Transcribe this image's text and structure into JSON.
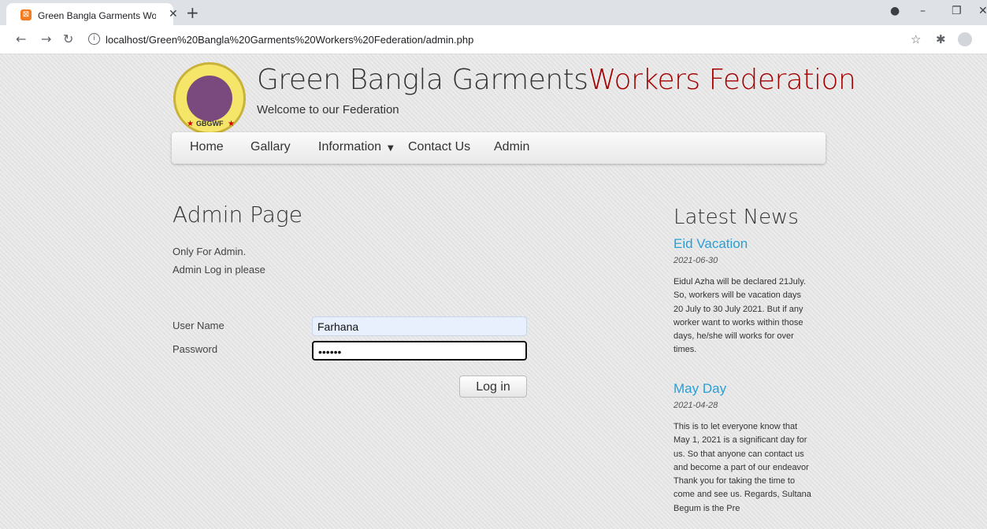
{
  "browser": {
    "tab_title": "Green Bangla Garments Workers",
    "url": "localhost/Green%20Bangla%20Garments%20Workers%20Federation/admin.php"
  },
  "site": {
    "title_main": "Green Bangla Garments",
    "title_accent": "Workers Federation",
    "tagline": "Welcome to our Federation",
    "logo_text": "GBGWF"
  },
  "nav": {
    "home": "Home",
    "gallary": "Gallary",
    "information": "Information",
    "contact": "Contact Us",
    "admin": "Admin"
  },
  "admin": {
    "heading": "Admin Page",
    "line1": "Only For Admin.",
    "line2": "Admin Log in please",
    "username_label": "User Name",
    "username_value": "Farhana",
    "password_label": "Password",
    "password_value": "••••••",
    "login_label": "Log in"
  },
  "news": {
    "heading": "Latest News",
    "items": [
      {
        "title": "Eid Vacation",
        "date": "2021-06-30",
        "body": "Eidul Azha will be declared 21July. So, workers will be vacation days 20 July to 30 July 2021. But if any worker want to works within those days, he/she will works for over times."
      },
      {
        "title": "May Day",
        "date": "2021-04-28",
        "body": "This is to let everyone know that May 1, 2021 is a significant day for us. So that anyone can contact us and become a part of our endeavor Thank you for taking the time to come and see us. Regards, Sultana Begum is the Pre"
      }
    ]
  },
  "colors": {
    "accent_red": "#a30000",
    "link_blue": "#2a9fd6"
  }
}
